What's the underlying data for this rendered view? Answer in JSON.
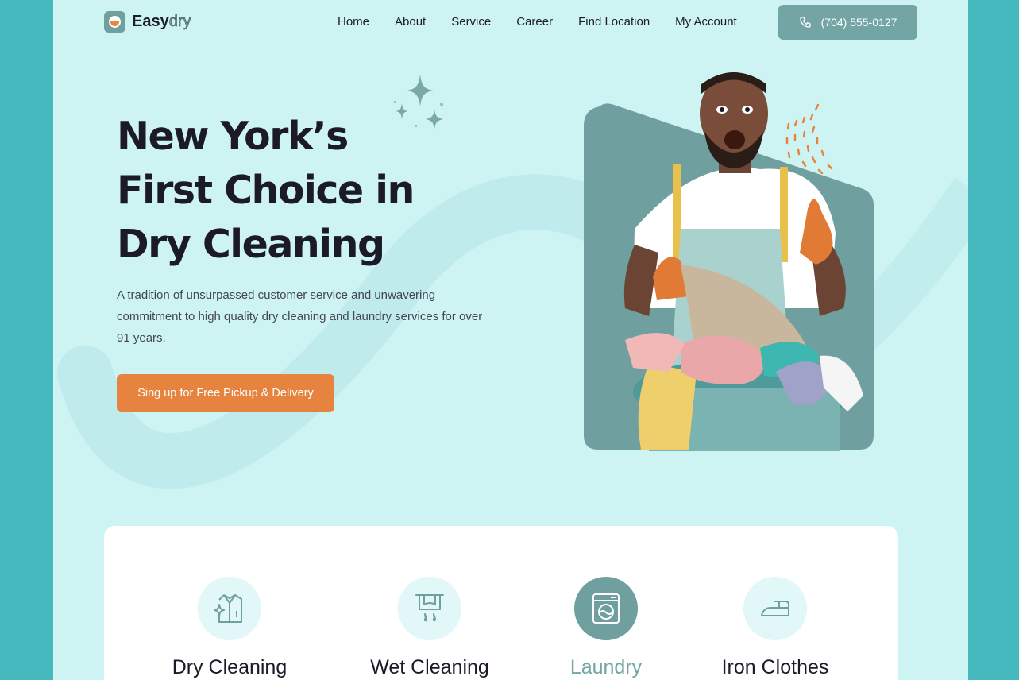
{
  "brand": {
    "name_bold": "Easy",
    "name_light": "dry"
  },
  "nav": {
    "items": [
      "Home",
      "About",
      "Service",
      "Career",
      "Find Location",
      "My Account"
    ]
  },
  "phone": {
    "label": "(704) 555-0127",
    "icon": "phone-icon"
  },
  "hero": {
    "title_lines": [
      "New York’s",
      "First Choice in",
      "Dry Cleaning"
    ],
    "description": "A tradition of unsurpassed customer service and unwavering commitment to high quality dry cleaning and laundry services for over 91 years.",
    "cta": "Sing up for Free Pickup & Delivery"
  },
  "services": [
    {
      "label": "Dry Cleaning",
      "icon": "shirt-icon",
      "active": false
    },
    {
      "label": "Wet Cleaning",
      "icon": "drying-rack-icon",
      "active": false
    },
    {
      "label": "Laundry",
      "icon": "washing-machine-icon",
      "active": true
    },
    {
      "label": "Iron Clothes",
      "icon": "iron-icon",
      "active": false
    }
  ],
  "colors": {
    "outer": "#45b9bd",
    "page": "#cdf4f3",
    "accent": "#72a5a4",
    "cta": "#e6843f",
    "text": "#1c1a26"
  }
}
